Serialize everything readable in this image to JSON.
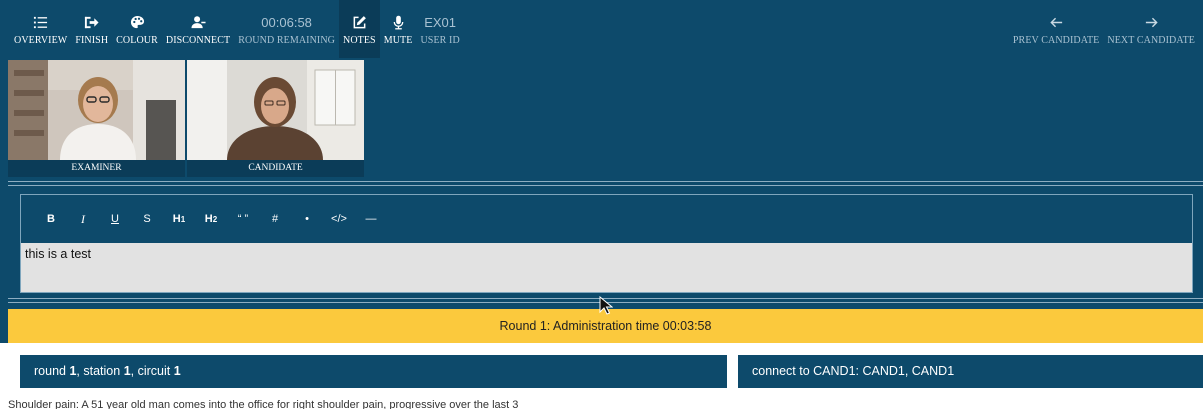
{
  "toolbar": {
    "overview": "OVERVIEW",
    "finish": "FINISH",
    "colour": "COLOUR",
    "disconnect": "DISCONNECT",
    "timer": "00:06:58",
    "round_remaining": "ROUND REMAINING",
    "notes": "NOTES",
    "mute": "MUTE",
    "user_code": "EX01",
    "user_id": "USER ID",
    "prev_candidate": "PREV CANDIDATE",
    "next_candidate": "NEXT CANDIDATE"
  },
  "icons": {
    "overview": "list-icon",
    "finish": "exit-icon",
    "colour": "palette-icon",
    "disconnect": "user-minus-icon",
    "notes": "edit-icon",
    "mute": "microphone-icon",
    "prev": "arrow-left-icon",
    "next": "arrow-right-icon"
  },
  "videos": {
    "examiner_label": "EXAMINER",
    "candidate_label": "CANDIDATE"
  },
  "editor": {
    "tools": [
      "B",
      "I",
      "U",
      "S",
      "H1",
      "H2",
      "“ ”",
      "#",
      "•",
      "</>",
      "—"
    ],
    "content": "this is a test"
  },
  "banner": {
    "text": "Round 1: Administration time 00:03:58"
  },
  "info": {
    "round_label": "round",
    "round_num": "1",
    "station_label": ", station",
    "station_num": "1",
    "circuit_label": ", circuit",
    "circuit_num": "1",
    "connect_text": "connect to CAND1: CAND1, CAND1"
  },
  "cutoff_text": "Shoulder pain: A 51 year old man comes into the office for right shoulder pain, progressive over the last 3",
  "colors": {
    "primary": "#0d4a6b",
    "accent": "#fbc93d",
    "editor_bg": "#e2e2e2",
    "active_tab": "#0b3c58"
  }
}
